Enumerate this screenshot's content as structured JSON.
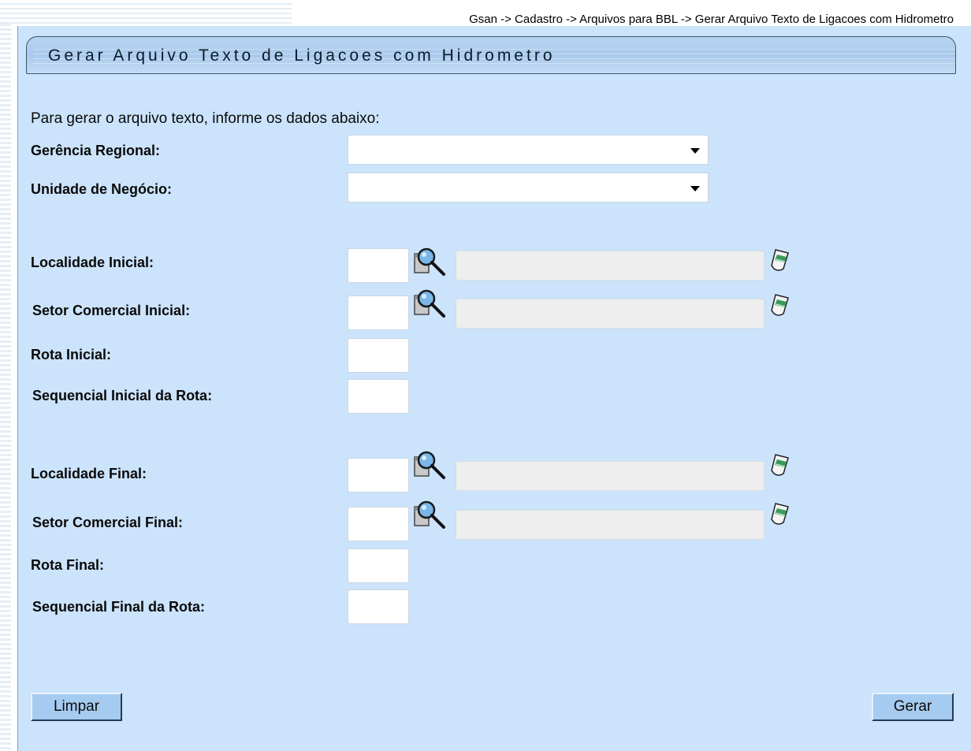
{
  "breadcrumb": "Gsan -> Cadastro -> Arquivos para BBL -> Gerar Arquivo Texto de Ligacoes com Hidrometro",
  "title": "Gerar Arquivo Texto de Ligacoes com Hidrometro",
  "intro": "Para gerar o arquivo texto, informe os dados abaixo:",
  "fields": {
    "gerencia_regional": "Gerência Regional:",
    "unidade_negocio": "Unidade de Negócio:",
    "localidade_inicial": "Localidade Inicial:",
    "setor_comercial_inicial": "Setor Comercial Inicial:",
    "rota_inicial": "Rota Inicial:",
    "sequencial_inicial": "Sequencial Inicial da Rota:",
    "localidade_final": "Localidade Final:",
    "setor_comercial_final": "Setor Comercial Final:",
    "rota_final": "Rota Final:",
    "sequencial_final": "Sequencial Final da Rota:"
  },
  "buttons": {
    "limpar": "Limpar",
    "gerar": "Gerar"
  },
  "icons": {
    "lookup": "magnifier-lookup-icon",
    "clear": "eraser-icon"
  },
  "colors": {
    "panel_bg": "#cbe3fb",
    "title_bar": "#a9c9ec",
    "button_bg": "#a6cbf0",
    "description_bg": "#eeeeee"
  }
}
